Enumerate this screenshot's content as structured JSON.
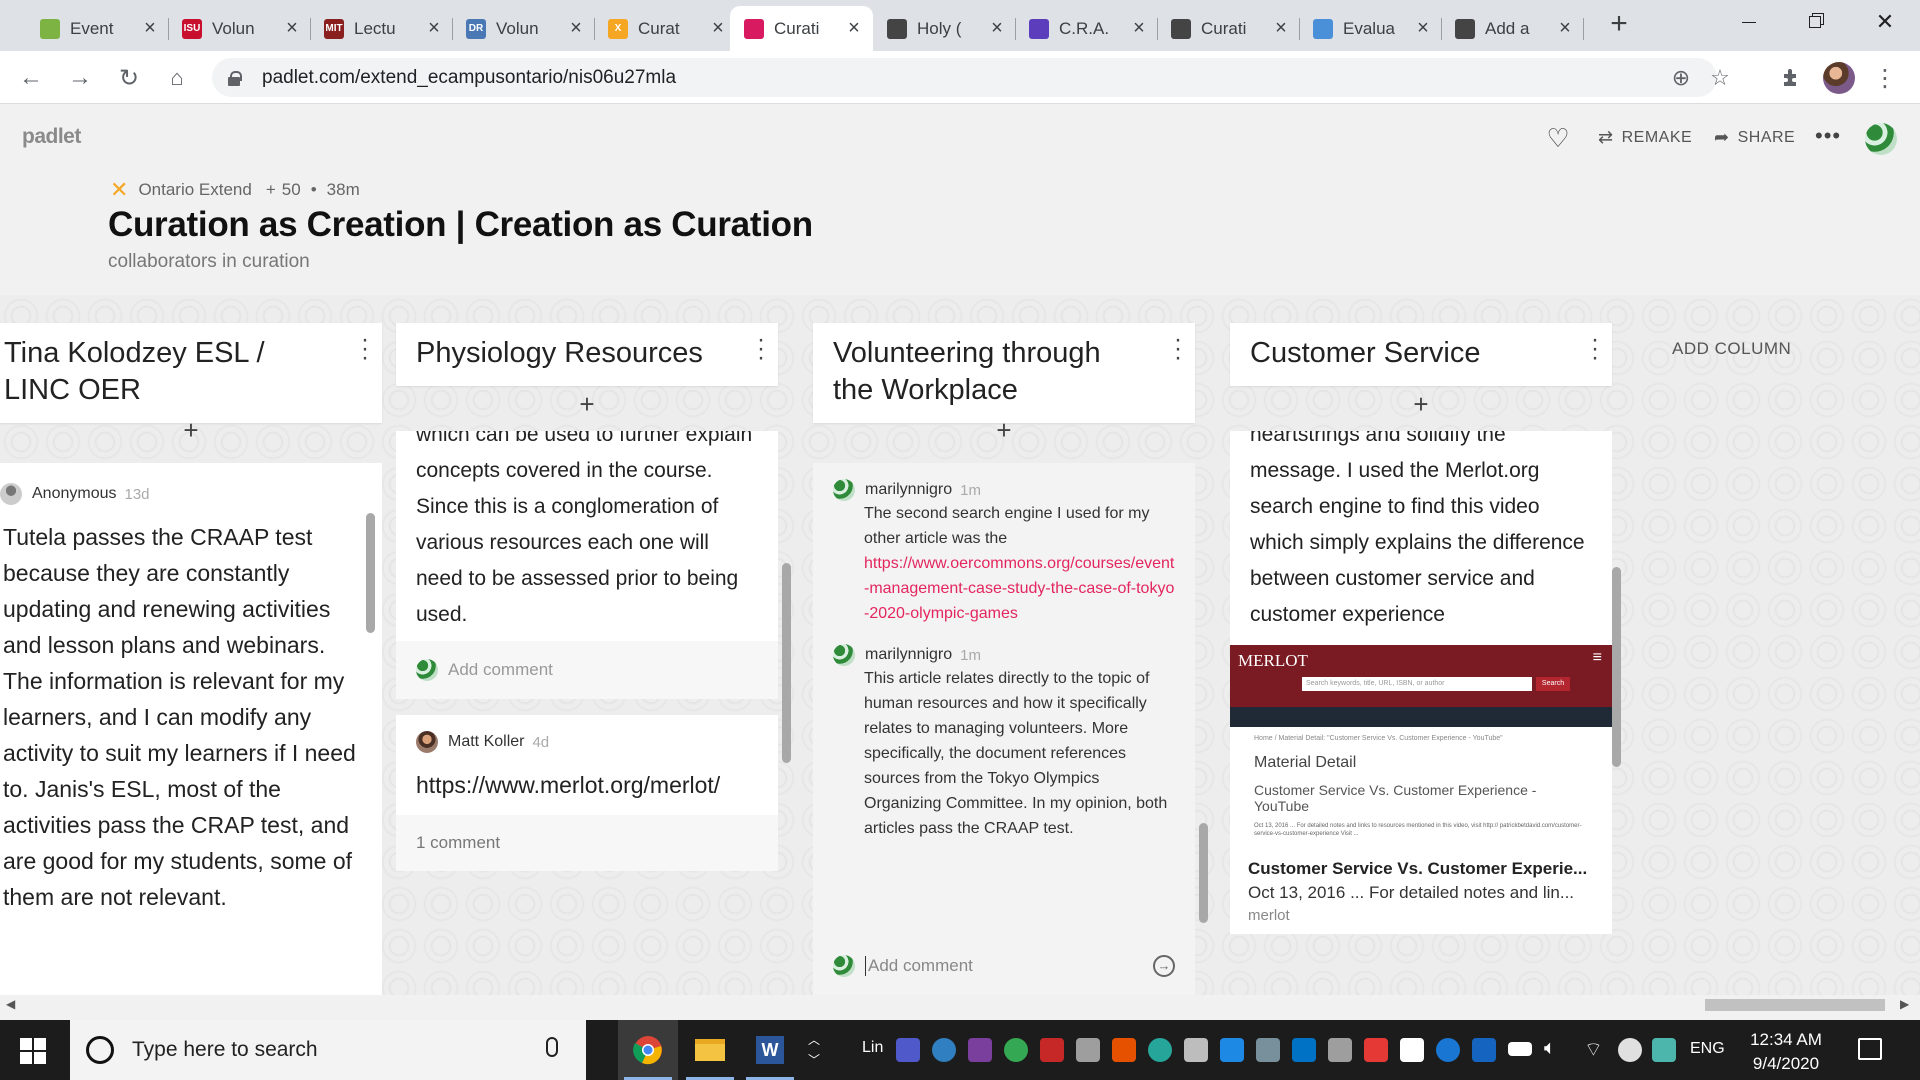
{
  "browser": {
    "tabs": [
      {
        "title": "Event",
        "favicon_color": "#7cb342",
        "favicon_text": ""
      },
      {
        "title": "Volun",
        "favicon_color": "#c8102e",
        "favicon_text": "ISU"
      },
      {
        "title": "Lectu",
        "favicon_color": "#8a1f1f",
        "favicon_text": "MIT"
      },
      {
        "title": "Volun",
        "favicon_color": "#4a78b5",
        "favicon_text": "DR"
      },
      {
        "title": "Curat",
        "favicon_color": "#f5a623",
        "favicon_text": "X"
      },
      {
        "title": "Curati",
        "favicon_color": "#d81b60",
        "favicon_text": ""
      },
      {
        "title": "Holy (",
        "favicon_color": "#444444",
        "favicon_text": ""
      },
      {
        "title": "C.R.A.",
        "favicon_color": "#5c3dbb",
        "favicon_text": ""
      },
      {
        "title": "Curati",
        "favicon_color": "#444444",
        "favicon_text": ""
      },
      {
        "title": "Evalua",
        "favicon_color": "#4a90d9",
        "favicon_text": ""
      },
      {
        "title": "Add a",
        "favicon_color": "#444444",
        "favicon_text": ""
      }
    ],
    "active_tab_index": 5,
    "url": "padlet.com/extend_ecampusontario/nis06u27mla"
  },
  "padlet": {
    "logo": "padlet",
    "actions": {
      "remake": "REMAKE",
      "share": "SHARE"
    },
    "meta": {
      "org": "Ontario Extend",
      "plus_count": "50",
      "age": "38m"
    },
    "title": "Curation as Creation | Creation as Curation",
    "subtitle": "collaborators in curation",
    "add_column": "ADD COLUMN",
    "columns": [
      {
        "title": "Tina Kolodzey ESL / LINC OER",
        "posts": [
          {
            "author": "Anonymous",
            "age": "13d",
            "body": "Tutela passes the CRAAP test because they are constantly updating and renewing activities and lesson plans and webinars.  The information is relevant for my learners, and I can modify any activity to suit my learners if I need to. Janis's ESL, most of the activities pass the CRAP test, and are good for my students, some of them are not relevant."
          }
        ]
      },
      {
        "title": "Physiology Resources",
        "posts": [
          {
            "body": "which can be used to further explain concepts covered in the course. Since this is a conglomeration of various resources each one will need to be assessed prior to being used.",
            "comment_placeholder": "Add comment"
          },
          {
            "author": "Matt Koller",
            "age": "4d",
            "body": "https://www.merlot.org/merlot/",
            "comments": "1 comment"
          }
        ]
      },
      {
        "title": "Volunteering through the Workplace",
        "comments": [
          {
            "author": "marilynnigro",
            "age": "1m",
            "text": "The second search engine I used for my other article was the",
            "link": "https://www.oercommons.org/courses/event-management-case-study-the-case-of-tokyo-2020-olympic-games"
          },
          {
            "author": "marilynnigro",
            "age": "1m",
            "text": "This article relates directly to the topic of human resources and how it specifically relates to managing volunteers. More specifically, the document references sources from the Tokyo Olympics Organizing Committee. In my opinion, both articles pass the CRAAP test."
          }
        ],
        "comment_placeholder": "Add comment"
      },
      {
        "title": "Customer Service",
        "posts": [
          {
            "body": "heartstrings and solidify the message.  I used the Merlot.org search engine to find this video which simply explains the difference between customer service and customer experience",
            "attachment": {
              "site_logo": "MERLOT",
              "search_placeholder": "Search keywords, title, URL, ISBN, or author",
              "search_button": "Search",
              "breadcrumb": "Home / Material Detail: \"Customer Service Vs. Customer Experience - YouTube\"",
              "section": "Material Detail",
              "material_title": "Customer Service Vs. Customer Experience - YouTube",
              "material_snippet": "Oct 13, 2016 ... For detailed notes and links to resources mentioned in this video, visit http:// patrickbetdavid.com/customer-service-vs-customer-experience Visit ...",
              "title": "Customer Service Vs. Customer Experie...",
              "snippet": "Oct 13, 2016 ... For detailed notes and lin...",
              "source": "merlot"
            }
          }
        ]
      }
    ]
  },
  "taskbar": {
    "search_placeholder": "Type here to search",
    "tray_label": "Lin",
    "language": "ENG",
    "time": "12:34 AM",
    "date": "9/4/2020"
  }
}
